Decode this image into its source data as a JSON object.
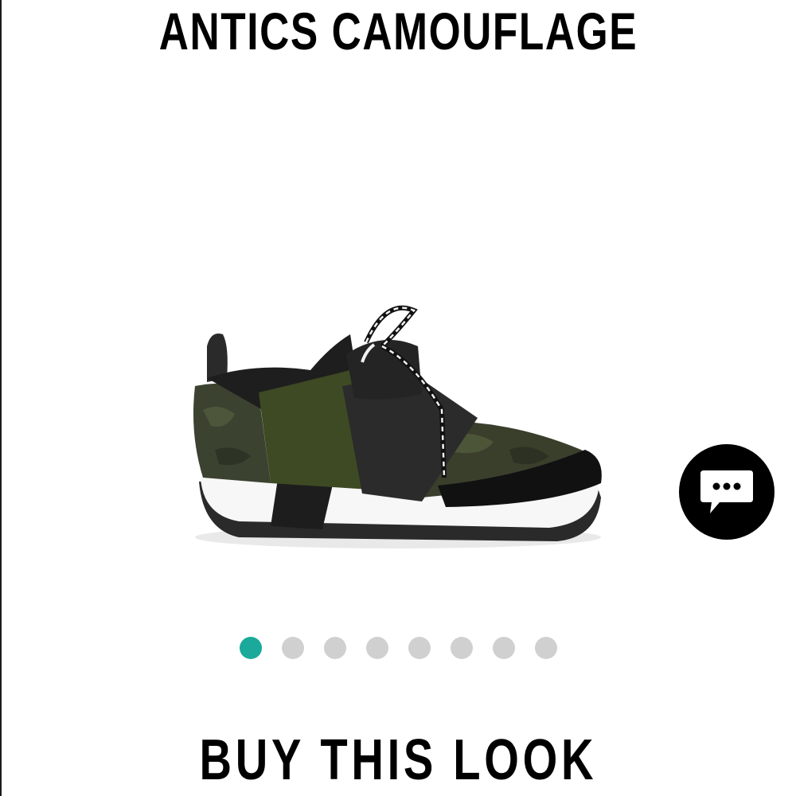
{
  "product": {
    "title": "ANTICS CAMOUFLAGE",
    "image_alt": "Camouflage slip-on sneaker with striped laces"
  },
  "carousel": {
    "slide_count": 8,
    "active_index": 0,
    "active_color": "#1aa99a",
    "inactive_color": "#d0d0d0"
  },
  "chat": {
    "icon": "chat-bubble-icon",
    "color": "#000000"
  },
  "section": {
    "buy_heading": "BUY THIS LOOK"
  }
}
